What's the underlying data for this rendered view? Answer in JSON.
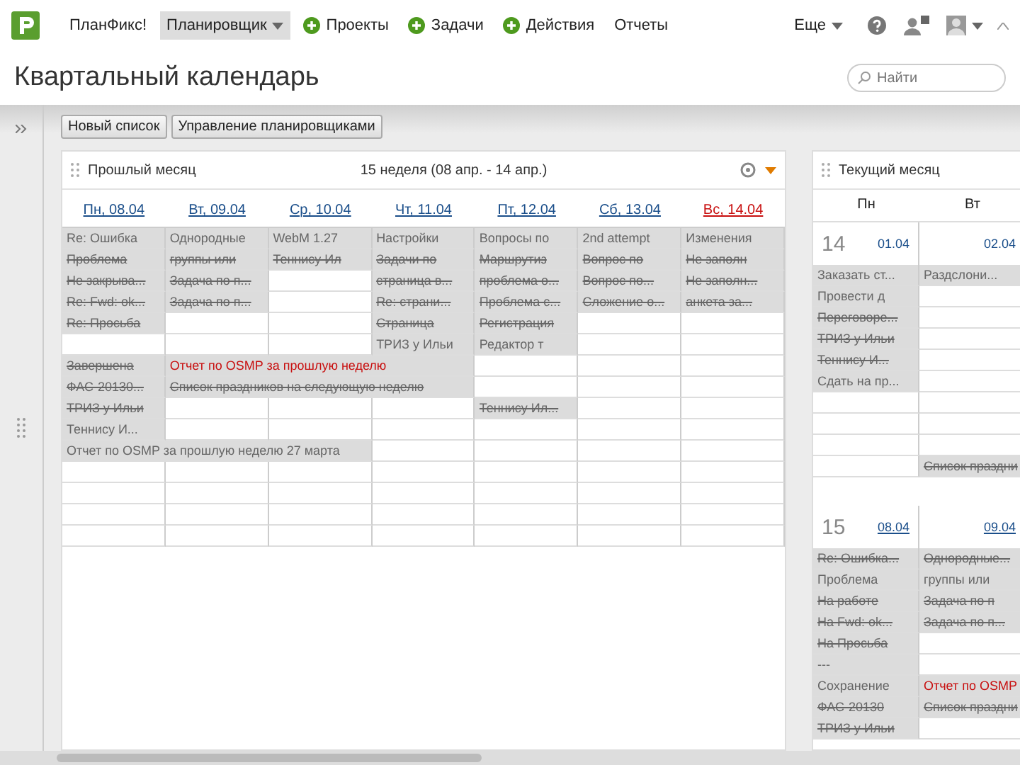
{
  "topbar": {
    "nav": [
      {
        "label": "ПланФикс!",
        "kind": "plain",
        "selected": false
      },
      {
        "label": "Планировщик",
        "kind": "dropdown",
        "selected": true
      },
      {
        "label": "Проекты",
        "kind": "add",
        "selected": false
      },
      {
        "label": "Задачи",
        "kind": "add",
        "selected": false
      },
      {
        "label": "Действия",
        "kind": "add",
        "selected": false
      },
      {
        "label": "Отчеты",
        "kind": "plain",
        "selected": false
      }
    ],
    "more": "Еще"
  },
  "page_title": "Квартальный календарь",
  "search": {
    "placeholder": "Найти"
  },
  "toolbar": [
    "Новый список",
    "Управление планировщиками"
  ],
  "week_panel": {
    "title": "Прошлый месяц",
    "week_label": "15 неделя (08 апр. - 14 апр.)",
    "days": [
      {
        "label": "Пн, 08.04",
        "weekend": false
      },
      {
        "label": "Вт, 09.04",
        "weekend": false
      },
      {
        "label": "Ср, 10.04",
        "weekend": false
      },
      {
        "label": "Чт, 11.04",
        "weekend": false
      },
      {
        "label": "Пт, 12.04",
        "weekend": false
      },
      {
        "label": "Сб, 13.04",
        "weekend": false
      },
      {
        "label": "Вс, 14.04",
        "weekend": true
      }
    ],
    "rows": [
      [
        {
          "kind": "event",
          "text": "Re: Ошибка",
          "done": false,
          "urgent": false
        },
        {
          "kind": "event",
          "text": "Однородные",
          "done": false,
          "urgent": false
        },
        {
          "kind": "event",
          "text": "WebM 1.27",
          "done": false,
          "urgent": false
        },
        {
          "kind": "event",
          "text": "Настройки",
          "done": false,
          "urgent": false
        },
        {
          "kind": "event",
          "text": "Вопросы по",
          "done": false,
          "urgent": false
        },
        {
          "kind": "event",
          "text": "2nd attempt",
          "done": false,
          "urgent": false
        },
        {
          "kind": "event",
          "text": "Изменения",
          "done": false,
          "urgent": false
        }
      ],
      [
        {
          "kind": "event",
          "text": "Проблема",
          "done": true,
          "urgent": false
        },
        {
          "kind": "event",
          "text": "группы или",
          "done": true,
          "urgent": false
        },
        {
          "kind": "event",
          "text": "Теннису Ил",
          "done": true,
          "urgent": false
        },
        {
          "kind": "event",
          "text": "Задачи по",
          "done": true,
          "urgent": false
        },
        {
          "kind": "event",
          "text": "Маршрутиз",
          "done": true,
          "urgent": false
        },
        {
          "kind": "event",
          "text": "Вопрос по",
          "done": true,
          "urgent": false
        },
        {
          "kind": "event",
          "text": "Не заполн",
          "done": true,
          "urgent": false
        }
      ],
      [
        {
          "kind": "event",
          "text": "Не закрыва...",
          "done": true,
          "urgent": false
        },
        {
          "kind": "event",
          "text": "Задача по п...",
          "done": true,
          "urgent": false
        },
        {
          "kind": "empty"
        },
        {
          "kind": "event",
          "text": "страница в...",
          "done": true,
          "urgent": false
        },
        {
          "kind": "event",
          "text": "проблема о...",
          "done": true,
          "urgent": false
        },
        {
          "kind": "event",
          "text": "Вопрос по...",
          "done": true,
          "urgent": false
        },
        {
          "kind": "event",
          "text": "Не заполн...",
          "done": true,
          "urgent": false
        }
      ],
      [
        {
          "kind": "event",
          "text": "Re: Fwd: ok...",
          "done": true,
          "urgent": false
        },
        {
          "kind": "event",
          "text": "Задача по п...",
          "done": true,
          "urgent": false
        },
        {
          "kind": "empty"
        },
        {
          "kind": "event",
          "text": "Re: страни...",
          "done": true,
          "urgent": false
        },
        {
          "kind": "event",
          "text": "Проблема с...",
          "done": true,
          "urgent": false
        },
        {
          "kind": "event",
          "text": "Сложение о...",
          "done": true,
          "urgent": false
        },
        {
          "kind": "event",
          "text": "анкета за...",
          "done": true,
          "urgent": false
        }
      ],
      [
        {
          "kind": "event",
          "text": "Re: Просьба",
          "done": true,
          "urgent": false
        },
        {
          "kind": "empty"
        },
        {
          "kind": "empty"
        },
        {
          "kind": "event",
          "text": "Страница",
          "done": true,
          "urgent": false
        },
        {
          "kind": "event",
          "text": "Регистрация",
          "done": true,
          "urgent": false
        },
        {
          "kind": "empty"
        },
        {
          "kind": "empty"
        }
      ],
      [
        {
          "kind": "empty"
        },
        {
          "kind": "empty"
        },
        {
          "kind": "empty"
        },
        {
          "kind": "event",
          "text": "ТРИЗ у Ильи",
          "done": false,
          "urgent": false
        },
        {
          "kind": "event",
          "text": "Редактор т",
          "done": false,
          "urgent": false
        },
        {
          "kind": "empty"
        },
        {
          "kind": "empty"
        }
      ],
      [
        {
          "kind": "event",
          "text": "Завершена",
          "done": true,
          "urgent": false
        },
        {
          "kind": "wide",
          "text": "Отчет по OSMP за прошлую неделю",
          "done": false,
          "urgent": true
        },
        {
          "kind": "empty"
        },
        {
          "kind": "empty"
        },
        {
          "kind": "empty"
        }
      ],
      [
        {
          "kind": "event",
          "text": "ФАС-20130...",
          "done": true,
          "urgent": false
        },
        {
          "kind": "wide",
          "text": "Список праздников на следующую неделю",
          "done": true,
          "urgent": false
        },
        {
          "kind": "empty"
        },
        {
          "kind": "empty"
        },
        {
          "kind": "empty"
        }
      ],
      [
        {
          "kind": "event",
          "text": "ТРИЗ у Ильи",
          "done": true,
          "urgent": false
        },
        {
          "kind": "empty"
        },
        {
          "kind": "empty"
        },
        {
          "kind": "empty"
        },
        {
          "kind": "event",
          "text": "Теннису Ил...",
          "done": true,
          "urgent": false
        },
        {
          "kind": "empty"
        },
        {
          "kind": "empty"
        }
      ],
      [
        {
          "kind": "event",
          "text": "Теннису И...",
          "done": false,
          "urgent": false
        },
        {
          "kind": "empty"
        },
        {
          "kind": "empty"
        },
        {
          "kind": "empty"
        },
        {
          "kind": "empty"
        },
        {
          "kind": "empty"
        },
        {
          "kind": "empty"
        }
      ],
      [
        {
          "kind": "wide",
          "text": "Отчет по OSMP за прошлую неделю 27 марта",
          "done": false,
          "urgent": false
        },
        {
          "kind": "empty"
        },
        {
          "kind": "empty"
        },
        {
          "kind": "empty"
        },
        {
          "kind": "empty"
        }
      ]
    ]
  },
  "month_panel": {
    "title": "Текущий месяц",
    "weekdays": [
      "Пн",
      "Вт"
    ],
    "weeks": [
      {
        "number": "14",
        "dates": [
          "01.04",
          "02.04"
        ],
        "rows": [
          [
            {
              "kind": "event",
              "text": "Заказать ст...",
              "done": false,
              "urgent": false
            },
            {
              "kind": "event",
              "text": "Раздслони...",
              "done": false,
              "urgent": false
            }
          ],
          [
            {
              "kind": "event",
              "text": "Провести д",
              "done": false,
              "urgent": false
            },
            {
              "kind": "empty"
            }
          ],
          [
            {
              "kind": "event",
              "text": "Переговоре...",
              "done": true,
              "urgent": false
            },
            {
              "kind": "empty"
            }
          ],
          [
            {
              "kind": "event",
              "text": "ТРИЗ у Ильи",
              "done": true,
              "urgent": false
            },
            {
              "kind": "empty"
            }
          ],
          [
            {
              "kind": "event",
              "text": "Теннису И...",
              "done": true,
              "urgent": false
            },
            {
              "kind": "empty"
            }
          ],
          [
            {
              "kind": "event",
              "text": "Сдать на пр...",
              "done": false,
              "urgent": false
            },
            {
              "kind": "empty"
            }
          ],
          [
            {
              "kind": "empty"
            },
            {
              "kind": "empty"
            }
          ],
          [
            {
              "kind": "empty"
            },
            {
              "kind": "empty"
            }
          ],
          [
            {
              "kind": "empty"
            },
            {
              "kind": "empty"
            }
          ],
          [
            {
              "kind": "empty"
            },
            {
              "kind": "event",
              "text": "Список праздни",
              "done": true,
              "urgent": false
            }
          ]
        ]
      },
      {
        "number": "15",
        "dates": [
          "08.04",
          "09.04"
        ],
        "rows": [
          [
            {
              "kind": "event",
              "text": "Re: Ошибка...",
              "done": true,
              "urgent": false
            },
            {
              "kind": "event",
              "text": "Однородные...",
              "done": true,
              "urgent": false
            }
          ],
          [
            {
              "kind": "event",
              "text": "Проблема",
              "done": false,
              "urgent": false
            },
            {
              "kind": "event",
              "text": "группы или",
              "done": false,
              "urgent": false
            }
          ],
          [
            {
              "kind": "event",
              "text": "На работе",
              "done": true,
              "urgent": false
            },
            {
              "kind": "event",
              "text": "Задача по п",
              "done": true,
              "urgent": false
            }
          ],
          [
            {
              "kind": "event",
              "text": "На Fwd: ok...",
              "done": true,
              "urgent": false
            },
            {
              "kind": "event",
              "text": "Задача по п...",
              "done": true,
              "urgent": false
            }
          ],
          [
            {
              "kind": "event",
              "text": "На Просьба",
              "done": true,
              "urgent": false
            },
            {
              "kind": "empty"
            }
          ],
          [
            {
              "kind": "event",
              "text": "---",
              "done": false,
              "urgent": false
            },
            {
              "kind": "empty"
            }
          ],
          [
            {
              "kind": "event",
              "text": "Сохранение",
              "done": false,
              "urgent": false
            },
            {
              "kind": "event",
              "text": "Отчет по OSMP",
              "done": false,
              "urgent": true
            }
          ],
          [
            {
              "kind": "event",
              "text": "ФАС-20130",
              "done": true,
              "urgent": false
            },
            {
              "kind": "event",
              "text": "Список праздни",
              "done": true,
              "urgent": false
            }
          ],
          [
            {
              "kind": "event",
              "text": "ТРИЗ у Ильи",
              "done": true,
              "urgent": false
            },
            {
              "kind": "empty"
            }
          ]
        ]
      }
    ]
  }
}
